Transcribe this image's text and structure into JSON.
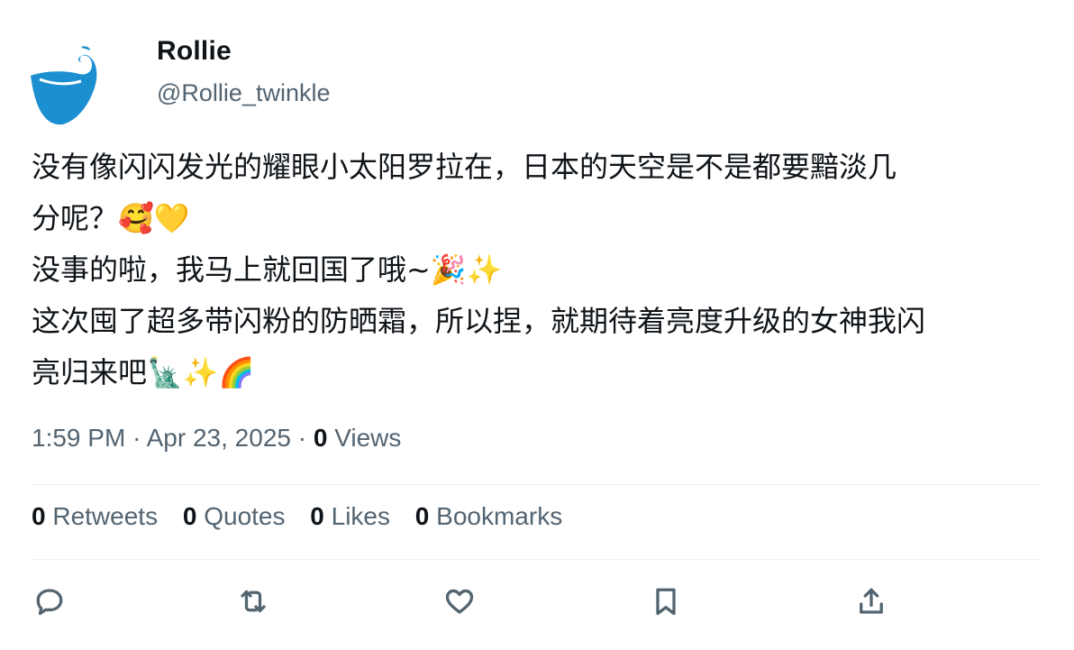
{
  "user": {
    "name": "Rollie",
    "handle": "@Rollie_twinkle",
    "avatar_icon": "swan-logo-icon",
    "avatar_color": "#1b8fd0"
  },
  "tweet": {
    "lines": [
      "没有像闪闪发光的耀眼小太阳罗拉在，日本的天空是不是都要黯淡几",
      "分呢？🥰💛",
      "没事的啦，我马上就回国了哦~🎉✨",
      "这次囤了超多带闪粉的防晒霜，所以捏，就期待着亮度升级的女神我闪",
      "亮归来吧🗽✨🌈"
    ]
  },
  "meta": {
    "time": "1:59 PM",
    "date": "Apr 23, 2025",
    "views_count": "0",
    "views_label": "Views"
  },
  "stats": {
    "retweets_count": "0",
    "retweets_label": "Retweets",
    "quotes_count": "0",
    "quotes_label": "Quotes",
    "likes_count": "0",
    "likes_label": "Likes",
    "bookmarks_count": "0",
    "bookmarks_label": "Bookmarks"
  },
  "actions": [
    "reply-icon",
    "retweet-icon",
    "like-icon",
    "bookmark-icon",
    "share-icon"
  ],
  "colors": {
    "text": "#0f1419",
    "secondary": "#536471",
    "divider": "#eff3f4"
  }
}
